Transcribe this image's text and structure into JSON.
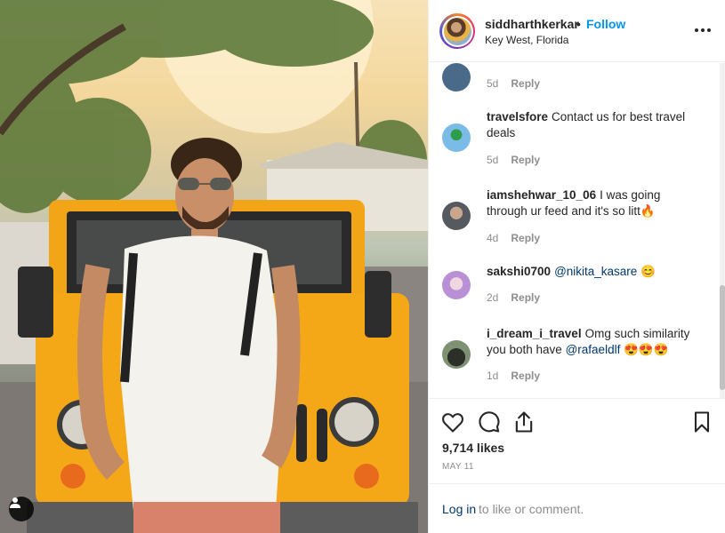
{
  "post": {
    "username": "siddharthkerkar",
    "separator": "•",
    "follow_label": "Follow",
    "location": "Key West, Florida",
    "likes": "9,714 likes",
    "date": "MAY 11"
  },
  "comments": [
    {
      "username": "",
      "text": "",
      "age": "5d",
      "reply": "Reply",
      "avatar_color": "#4a6a8a"
    },
    {
      "username": "travelsfore",
      "text": "Contact us for best travel deals",
      "age": "5d",
      "reply": "Reply",
      "avatar_color": "#3f8fd0"
    },
    {
      "username": "iamshehwar_10_06",
      "text": "I was going through ur feed and it's so litt🔥",
      "age": "4d",
      "reply": "Reply",
      "avatar_color": "#6b6f74"
    },
    {
      "username": "sakshi0700",
      "mention": "@nikita_kasare",
      "emoji": "😊",
      "age": "2d",
      "reply": "Reply",
      "avatar_color": "#b98fd6"
    },
    {
      "username": "i_dream_i_travel",
      "text": "Omg such similarity you both have",
      "mention": "@rafaeldlf",
      "emoji": "😍😍😍",
      "age": "1d",
      "reply": "Reply",
      "avatar_color": "#3e4a38"
    }
  ],
  "login": {
    "link_label": "Log in",
    "rest": "to like or comment."
  },
  "icons": [
    "heart-icon",
    "comment-icon",
    "share-icon",
    "bookmark-icon",
    "more-icon",
    "user-tag-icon"
  ],
  "colors": {
    "accent": "#0095f6",
    "link": "#00376b",
    "muted": "#8e8e8e",
    "text": "#262626"
  }
}
